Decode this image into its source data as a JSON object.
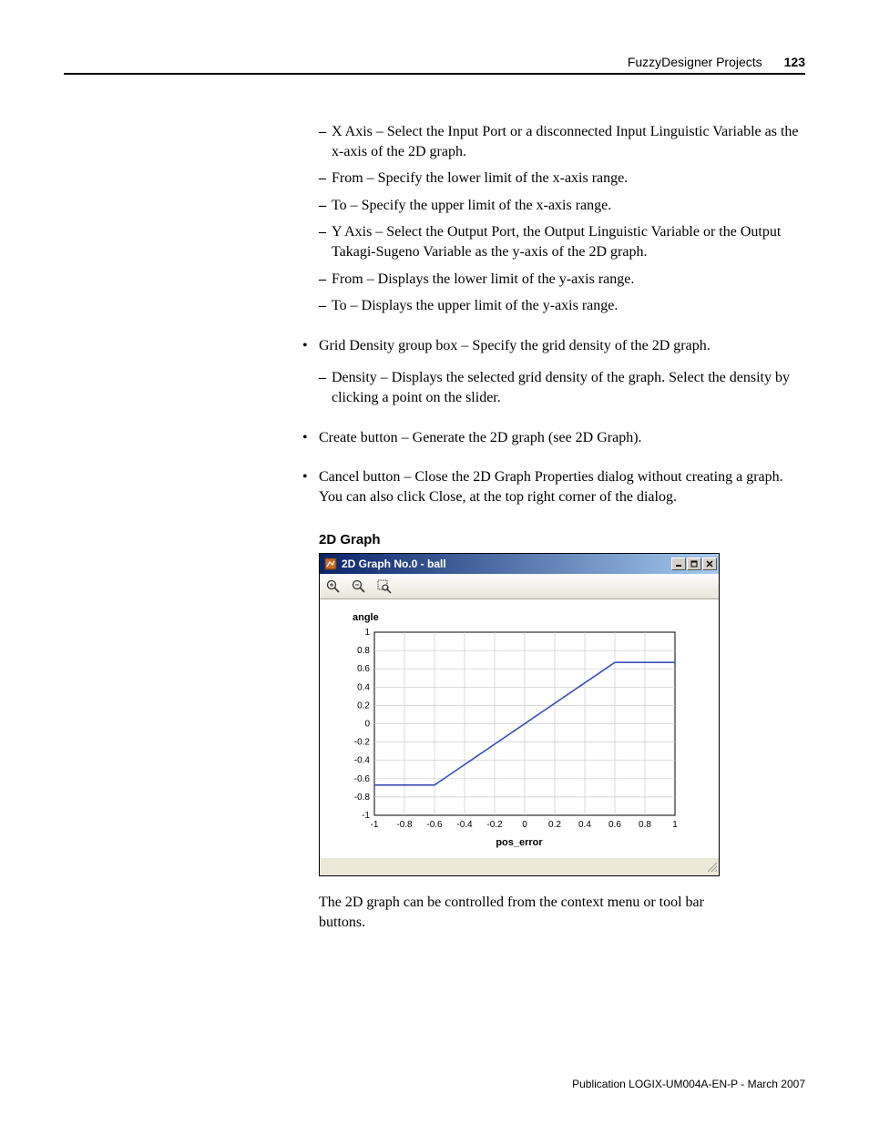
{
  "header": {
    "chapter": "FuzzyDesigner Projects",
    "page": "123"
  },
  "dash_items": [
    "X Axis – Select the Input Port or a disconnected Input Linguistic Variable as the x-axis of the 2D graph.",
    "From – Specify the lower limit of the x-axis range.",
    "To – Specify the upper limit of the x-axis range.",
    "Y Axis – Select the Output Port, the Output Linguistic Variable or the Output Takagi-Sugeno Variable as the y-axis of the 2D graph.",
    "From – Displays the lower limit of the y-axis range.",
    "To – Displays the upper limit of the y-axis range."
  ],
  "bullets": [
    {
      "text": "Grid Density group box – Specify the grid density of the 2D graph.",
      "sub": [
        "Density – Displays the selected grid density of the graph. Select the density by clicking a point on the slider."
      ]
    },
    {
      "text": "Create button – Generate the 2D graph (see 2D Graph).",
      "sub": []
    },
    {
      "text": "Cancel button – Close the 2D Graph Properties dialog without creating a graph. You can also click Close, at the top right corner of the dialog.",
      "sub": []
    }
  ],
  "section_title": "2D Graph",
  "window": {
    "title": "2D Graph No.0 - ball",
    "ylabel": "angle",
    "xlabel": "pos_error",
    "xticks": [
      "-1",
      "-0.8",
      "-0.6",
      "-0.4",
      "-0.2",
      "0",
      "0.2",
      "0.4",
      "0.6",
      "0.8",
      "1"
    ],
    "yticks": [
      "1",
      "0.8",
      "0.6",
      "0.4",
      "0.2",
      "0",
      "-0.2",
      "-0.4",
      "-0.6",
      "-0.8",
      "-1"
    ]
  },
  "chart_data": {
    "type": "line",
    "title": "2D Graph No.0 - ball",
    "xlabel": "pos_error",
    "ylabel": "angle",
    "xlim": [
      -1,
      1
    ],
    "ylim": [
      -1,
      1
    ],
    "x": [
      -1.0,
      -0.6,
      0.6,
      1.0
    ],
    "y": [
      -0.67,
      -0.67,
      0.67,
      0.67
    ]
  },
  "after_text": "The 2D graph can be controlled from the context menu or tool bar buttons.",
  "footer": "Publication LOGIX-UM004A-EN-P - March 2007"
}
